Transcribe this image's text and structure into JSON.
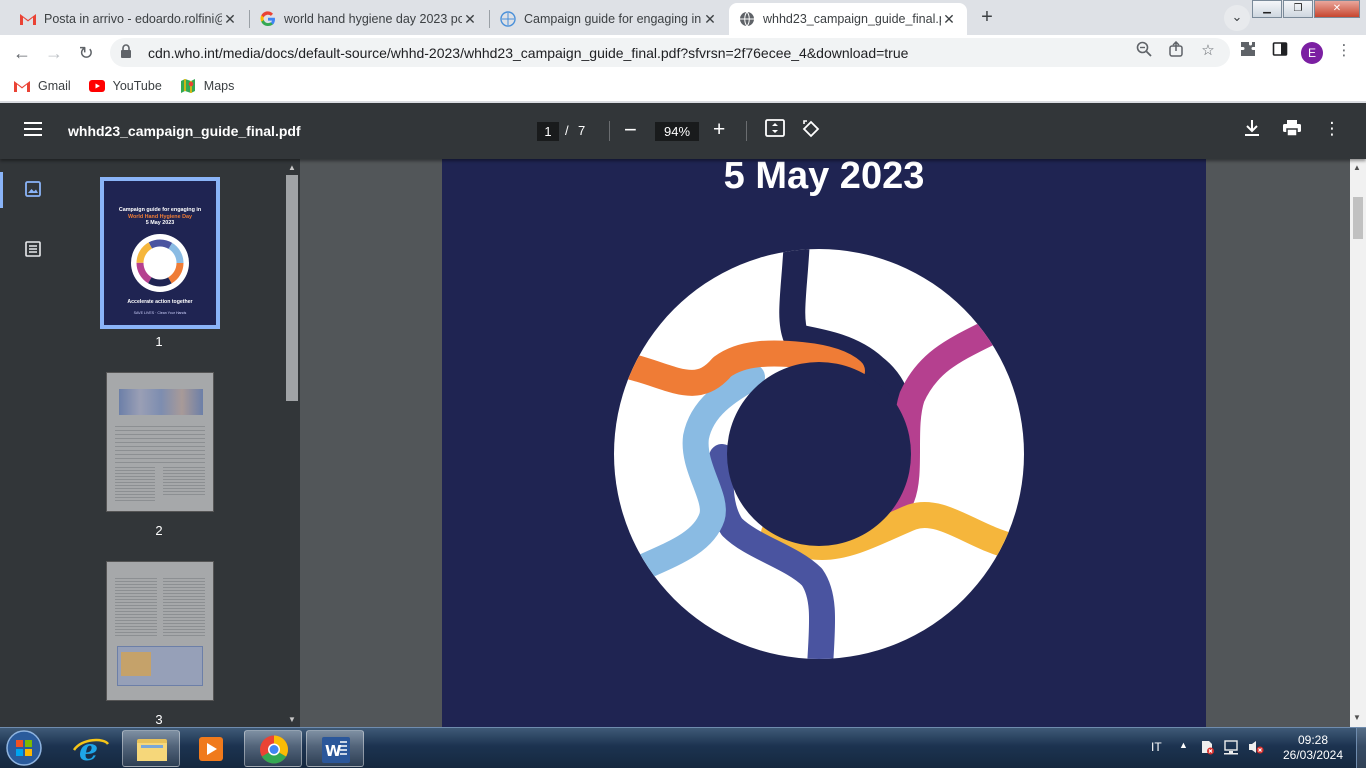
{
  "tabs": [
    {
      "title": "Posta in arrivo - edoardo.rolfini@",
      "icon": "gmail-icon"
    },
    {
      "title": "world hand hygiene day 2023 po",
      "icon": "google-icon"
    },
    {
      "title": "Campaign guide for engaging in",
      "icon": "who-icon"
    },
    {
      "title": "whhd23_campaign_guide_final.p",
      "icon": "globe-icon"
    }
  ],
  "address": {
    "url": "cdn.who.int/media/docs/default-source/whhd-2023/whhd23_campaign_guide_final.pdf?sfvrsn=2f76ecee_4&download=true"
  },
  "profile": {
    "initial": "E"
  },
  "bookmarks": [
    {
      "label": "Gmail"
    },
    {
      "label": "YouTube"
    },
    {
      "label": "Maps"
    }
  ],
  "pdf": {
    "filename": "whhd23_campaign_guide_final.pdf",
    "current_page": "1",
    "page_separator": "/",
    "total_pages": "7",
    "zoom": "94%"
  },
  "thumbnails": [
    {
      "number": "1",
      "title_line1": "Campaign guide for engaging in",
      "title_line2": "World Hand Hygiene Day",
      "title_line3": "5 May 2023",
      "tagline": "Accelerate action together",
      "footer": "SAVE LIVES · Clean Your Hands"
    },
    {
      "number": "2"
    },
    {
      "number": "3"
    }
  ],
  "page_content": {
    "date_title": "5 May 2023"
  },
  "colors": {
    "page_bg": "#1f2452",
    "hand_navy": "#1f2452",
    "hand_purple": "#b5408f",
    "hand_yellow": "#f5b63c",
    "hand_indigo": "#4a54a0",
    "hand_lightblue": "#8abbe3",
    "hand_orange": "#ef7c36"
  },
  "taskbar": {
    "language": "IT",
    "time": "09:28",
    "date": "26/03/2024"
  }
}
